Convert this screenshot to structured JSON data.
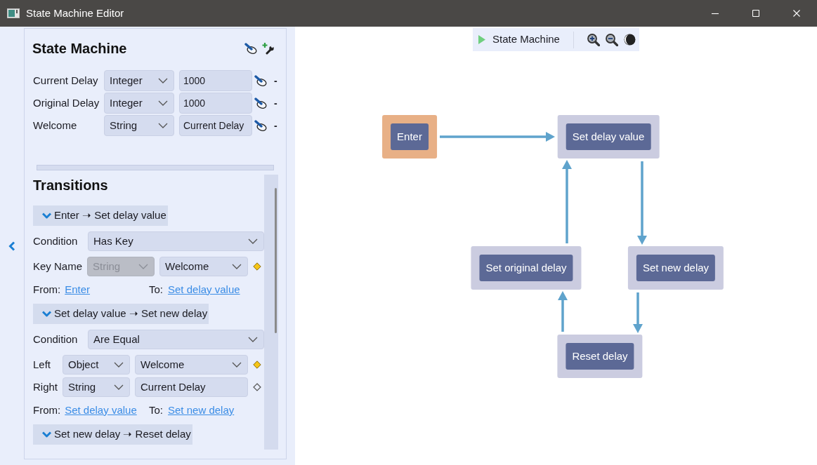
{
  "window": {
    "title": "State Machine Editor"
  },
  "state_machine": {
    "title": "State Machine",
    "variables": [
      {
        "name": "Current Delay",
        "type": "Integer",
        "value": "1000",
        "remove": "-"
      },
      {
        "name": "Original Delay",
        "type": "Integer",
        "value": "1000",
        "remove": "-"
      },
      {
        "name": "Welcome",
        "type": "String",
        "value": "Current Delay",
        "remove": "-"
      }
    ]
  },
  "transitions": {
    "title": "Transitions",
    "items": [
      {
        "header": "Enter ➝ Set delay value",
        "expanded": true,
        "condition_label": "Condition",
        "condition": "Has Key",
        "params": [
          {
            "label": "Key Name",
            "type": {
              "text": "String",
              "disabled": true
            },
            "value": {
              "kind": "dropdown",
              "text": "Welcome"
            },
            "linked": true
          }
        ],
        "from_label": "From:",
        "from": "Enter",
        "to_label": "To:",
        "to": "Set delay value"
      },
      {
        "header": "Set delay value ➝ Set new delay",
        "expanded": true,
        "condition_label": "Condition",
        "condition": "Are Equal",
        "params": [
          {
            "label": "Left",
            "type": {
              "text": "Object",
              "disabled": false
            },
            "value": {
              "kind": "dropdown",
              "text": "Welcome"
            },
            "linked": true
          },
          {
            "label": "Right",
            "type": {
              "text": "String",
              "disabled": false
            },
            "value": {
              "kind": "field",
              "text": "Current Delay"
            },
            "linked": false
          }
        ],
        "from_label": "From:",
        "from": "Set delay value",
        "to_label": "To:",
        "to": "Set new delay"
      },
      {
        "header": "Set new delay ➝ Reset delay",
        "expanded": true
      }
    ]
  },
  "toolbar": {
    "title": "State Machine"
  },
  "diagram": {
    "nodes": [
      {
        "label": "Enter",
        "color": "#e8b086"
      },
      {
        "label": "Set delay value",
        "color": "#cbcce0"
      },
      {
        "label": "Set original delay",
        "color": "#cbcce0"
      },
      {
        "label": "Set new delay",
        "color": "#cbcce0"
      },
      {
        "label": "Reset delay",
        "color": "#cbcce0"
      }
    ]
  }
}
